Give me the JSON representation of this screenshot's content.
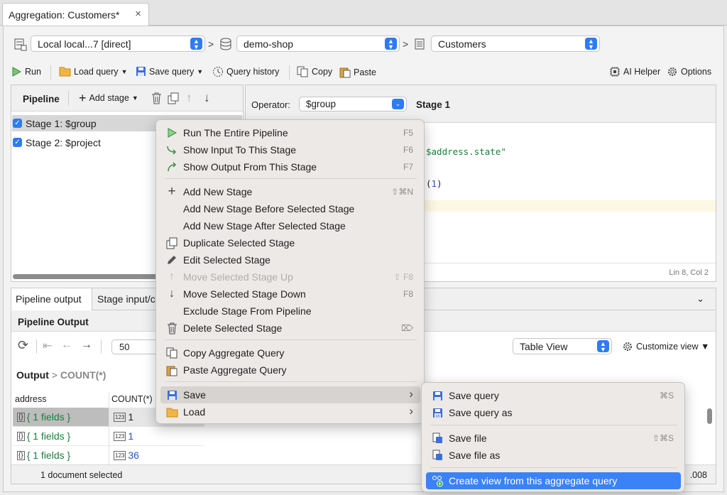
{
  "tab": {
    "title": "Aggregation: Customers*",
    "close": "×"
  },
  "connection": {
    "server": "Local local...7 [direct]",
    "database": "demo-shop",
    "collection": "Customers"
  },
  "toolbar": {
    "run": "Run",
    "load_query": "Load query",
    "save_query": "Save query",
    "query_history": "Query history",
    "copy": "Copy",
    "paste": "Paste",
    "ai_helper": "AI Helper",
    "options": "Options"
  },
  "pipeline": {
    "title": "Pipeline",
    "add_stage": "Add stage",
    "stages": [
      {
        "label": "Stage 1: $group",
        "checked": true,
        "selected": true
      },
      {
        "label": "Stage 2: $project",
        "checked": true,
        "selected": false
      }
    ]
  },
  "editor": {
    "operator_label": "Operator:",
    "operator_value": "$group",
    "stage_title": "Stage 1",
    "code_fragment_1": "$address.state\"",
    "code_fragment_2a": "(",
    "code_fragment_2b": "1",
    "code_fragment_2c": ")",
    "cursor_pos": "Lin 8, Col 2"
  },
  "output": {
    "tabs": [
      "Pipeline output",
      "Stage input/c"
    ],
    "section_title": "Pipeline Output",
    "page_size": "50",
    "view_mode": "Table View",
    "customize_view": "Customize view ▼",
    "breadcrumb_root": "Output",
    "breadcrumb_child": "COUNT(*)",
    "columns": [
      "address",
      "COUNT(*)"
    ],
    "rows": [
      {
        "address": "{ 1 fields }",
        "count": "1"
      },
      {
        "address": "{ 1 fields }",
        "count": "1"
      },
      {
        "address": "{ 1 fields }",
        "count": "36"
      }
    ],
    "status": "1 document selected",
    "timing": ".008"
  },
  "context_menu": {
    "items": [
      {
        "label": "Run The Entire Pipeline",
        "shortcut": "F5"
      },
      {
        "label": "Show Input To This Stage",
        "shortcut": "F6"
      },
      {
        "label": "Show Output From This Stage",
        "shortcut": "F7"
      },
      {
        "label": "Add New Stage",
        "shortcut": "⇧⌘N"
      },
      {
        "label": "Add New Stage Before Selected Stage",
        "shortcut": ""
      },
      {
        "label": "Add New Stage After Selected Stage",
        "shortcut": ""
      },
      {
        "label": "Duplicate Selected Stage",
        "shortcut": ""
      },
      {
        "label": "Edit Selected Stage",
        "shortcut": ""
      },
      {
        "label": "Move Selected Stage Up",
        "shortcut": "⇧ F8",
        "disabled": true
      },
      {
        "label": "Move Selected Stage Down",
        "shortcut": "F8"
      },
      {
        "label": "Exclude Stage From Pipeline",
        "shortcut": ""
      },
      {
        "label": "Delete Selected Stage",
        "shortcut": "⌦"
      },
      {
        "label": "Copy Aggregate Query",
        "shortcut": ""
      },
      {
        "label": "Paste Aggregate Query",
        "shortcut": ""
      },
      {
        "label": "Save",
        "shortcut": "›"
      },
      {
        "label": "Load",
        "shortcut": "›"
      }
    ]
  },
  "save_submenu": {
    "items": [
      {
        "label": "Save query",
        "shortcut": "⌘S"
      },
      {
        "label": "Save query as",
        "shortcut": ""
      },
      {
        "label": "Save file",
        "shortcut": "⇧⌘S"
      },
      {
        "label": "Save file as",
        "shortcut": ""
      },
      {
        "label": "Create view from this aggregate query",
        "shortcut": ""
      }
    ]
  },
  "colors": {
    "accent": "#2f7bf5",
    "menu_highlight": "#3b82f6",
    "json_green": "#1a7f3c",
    "number_blue": "#2154c9"
  }
}
